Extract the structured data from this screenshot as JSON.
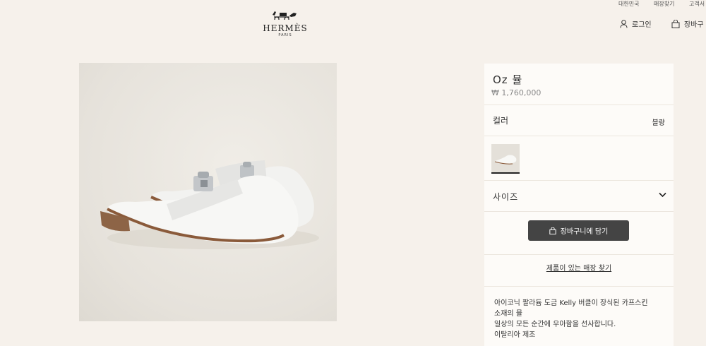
{
  "header": {
    "top_links": [
      "대한민국",
      "매장찾기",
      "고객서"
    ],
    "logo_text": "HERMÈS",
    "logo_sub": "PARIS",
    "login_label": "로그인",
    "cart_label": "장바구"
  },
  "product": {
    "title": "Oz 뮬",
    "price": "₩ 1,760,000",
    "color_label": "컬러",
    "color_value": "블랑",
    "size_label": "사이즈",
    "add_to_cart_label": "장바구니에 담기",
    "store_link_label": "제품이 있는 매장 찾기",
    "description_lines": [
      "아이코닉 팔라듐 도금 Kelly 버클이 장식된 카프스킨",
      "소재의 뮬",
      "일상의 모든 순간에 우아함을 선사합니다.",
      "이탈리아 제조"
    ]
  }
}
